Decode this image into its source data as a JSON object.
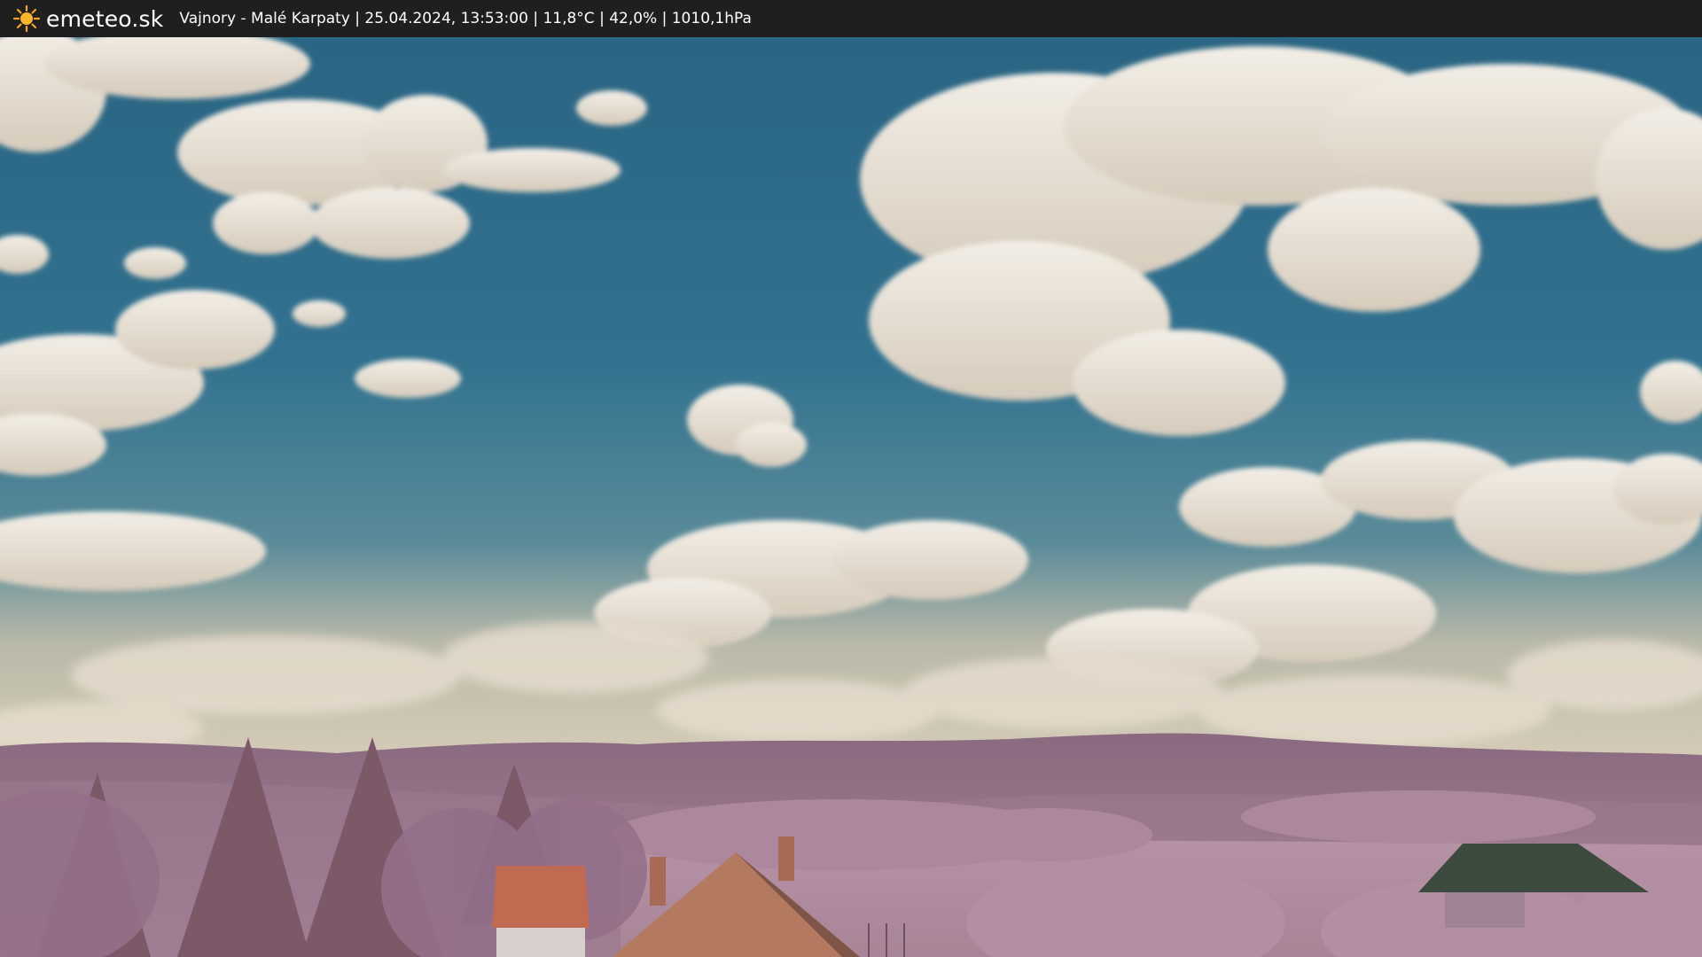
{
  "header": {
    "brand": "emeteo.sk",
    "logo_icon": "sun-icon",
    "caption": "Vajnory - Malé Karpaty | 25.04.2024, 13:53:00 | 11,8°C | 42,0% | 1010,1hPa"
  },
  "colors": {
    "header_bg": "#1f1f1f",
    "sky_top": "#2f6d8c",
    "sky_bottom": "#c9c0a8",
    "cloud": "#ebe4d8",
    "hills": "#9c7890",
    "foliage": "#b28aa0",
    "roof": "#c06a52"
  }
}
